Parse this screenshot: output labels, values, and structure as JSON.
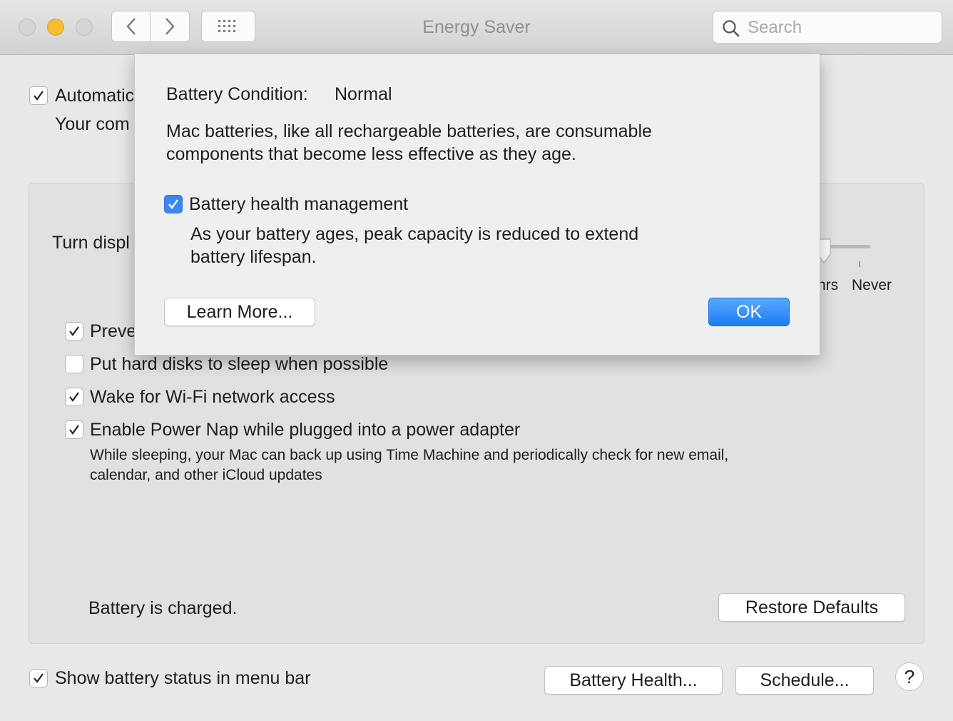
{
  "window": {
    "title": "Energy Saver"
  },
  "search": {
    "placeholder": "Search"
  },
  "background": {
    "automatic_label": "Automatic",
    "automatic_sub": "Your com",
    "turn_display_label": "Turn displ",
    "slider_labels": [
      "hrs",
      "Never"
    ],
    "prevent_label": "Preve",
    "hard_disks_label": "Put hard disks to sleep when possible",
    "wifi_label": "Wake for Wi-Fi network access",
    "power_nap_label": "Enable Power Nap while plugged into a power adapter",
    "power_nap_desc_1": "While sleeping, your Mac can back up using Time Machine and periodically check for new email,",
    "power_nap_desc_2": "calendar, and other iCloud updates",
    "battery_status": "Battery is charged.",
    "restore_defaults": "Restore Defaults",
    "show_battery_label": "Show battery status in menu bar",
    "battery_health_button": "Battery Health...",
    "schedule_button": "Schedule...",
    "help": "?"
  },
  "checkboxes": {
    "automatic": true,
    "prevent": true,
    "hard_disks": false,
    "wifi": true,
    "power_nap": true,
    "show_battery": true,
    "health_management": true
  },
  "sheet": {
    "condition_label": "Battery Condition:",
    "condition_value": "Normal",
    "desc_1": "Mac batteries, like all rechargeable batteries, are consumable",
    "desc_2": "components that become less effective as they age.",
    "health_label": "Battery health management",
    "health_desc_1": "As your battery ages, peak capacity is reduced to extend",
    "health_desc_2": "battery lifespan.",
    "learn_more": "Learn More...",
    "ok": "OK"
  },
  "colors": {
    "accent": "#1b7cf6",
    "checkbox_blue": "#3b86f0",
    "minimize": "#f5bd2f"
  }
}
